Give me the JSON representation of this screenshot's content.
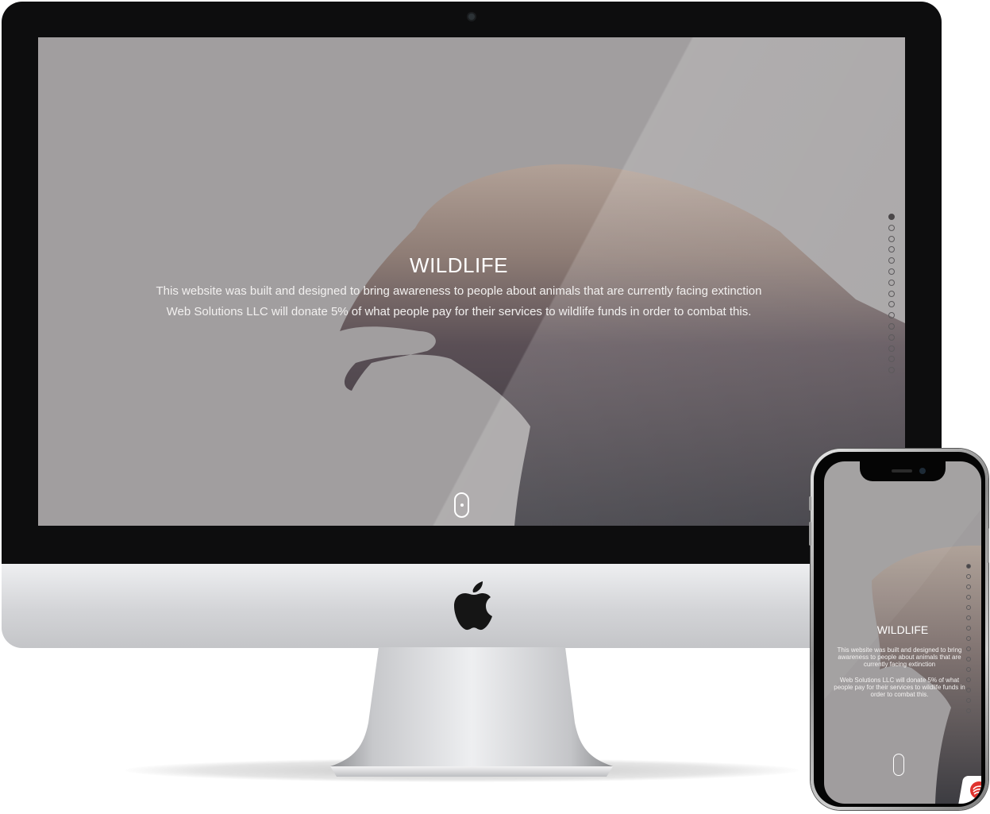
{
  "site": {
    "title": "WILDLIFE",
    "line1": "This website was built and designed to bring awareness to people about animals that are currently facing extinction",
    "line2": "Web Solutions LLC will donate 5% of what people pay for their services to wildlife funds in order to combat this."
  },
  "mobile": {
    "title": "WILDLIFE",
    "para1": "This website was built and designed to bring awareness to people about animals that are currently facing extinction",
    "para2": "Web Solutions LLC will donate 5% of what people pay for their services to wildlife funds in order to combat this."
  },
  "section_nav": {
    "count": 15,
    "active_index": 0
  },
  "icons": {
    "scroll": "mouse-scroll-icon",
    "brand": "apple-logo-icon",
    "badge": "red-swirl-logo-icon"
  },
  "colors": {
    "overlay_gray": "#a19e9f",
    "text": "#ffffff",
    "active_dot": "#4a4749"
  }
}
